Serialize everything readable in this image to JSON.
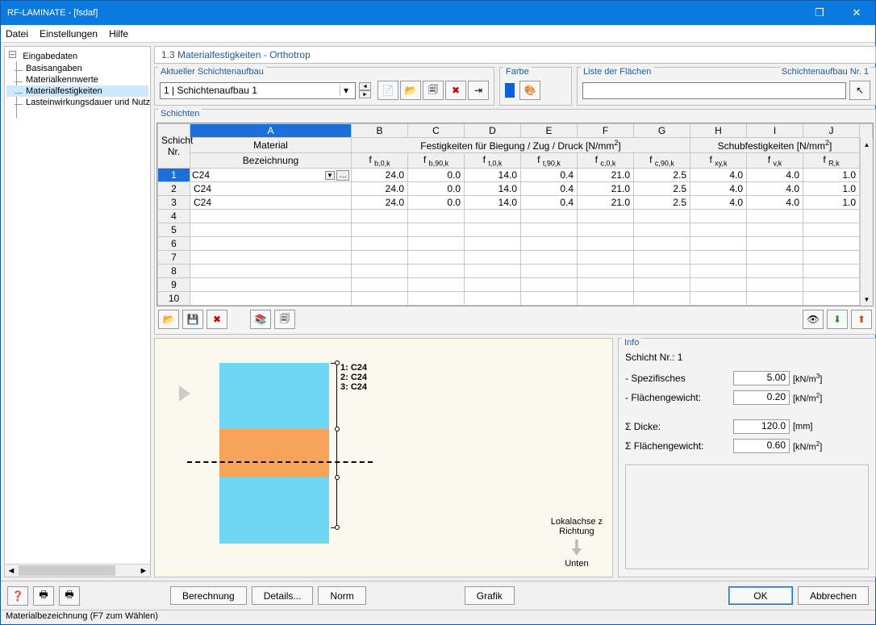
{
  "window": {
    "title": "RF-LAMINATE - [fsdaf]"
  },
  "menu": {
    "file": "Datei",
    "settings": "Einstellungen",
    "help": "Hilfe"
  },
  "tree": {
    "root": "Eingabedaten",
    "items": [
      "Basisangaben",
      "Materialkennwerte",
      "Materialfestigkeiten",
      "Lasteinwirkungsdauer und Nutzungsklasse"
    ],
    "selected_index": 2
  },
  "section_title": "1.3 Materialfestigkeiten - Orthotrop",
  "toolbar": {
    "current_layering": {
      "label": "Aktueller Schichtenaufbau",
      "value": "1 | Schichtenaufbau 1"
    },
    "color": {
      "label": "Farbe"
    },
    "faces": {
      "label": "Liste der Flächen",
      "right": "Schichtenaufbau Nr. 1"
    }
  },
  "grid": {
    "label": "Schichten",
    "col_letters": [
      "A",
      "B",
      "C",
      "D",
      "E",
      "F",
      "G",
      "H",
      "I",
      "J"
    ],
    "corner": "Schicht\nNr.",
    "h1_material": "Material",
    "h1_strength": "Festigkeiten für Biegung / Zug / Druck [N/mm²]",
    "h1_shear": "Schubfestigkeiten [N/mm²]",
    "h2_designation": "Bezeichnung",
    "h2_cols": [
      "f b,0,k",
      "f b,90,k",
      "f t,0,k",
      "f t,90,k",
      "f c,0,k",
      "f c,90,k",
      "f xy,k",
      "f v,k",
      "f R,k"
    ],
    "rows": [
      {
        "n": "1",
        "mat": "C24",
        "b0": "24.0",
        "b90": "0.0",
        "t0": "14.0",
        "t90": "0.4",
        "c0": "21.0",
        "c90": "2.5",
        "xy": "4.0",
        "v": "4.0",
        "r": "1.0",
        "sel": true
      },
      {
        "n": "2",
        "mat": "C24",
        "b0": "24.0",
        "b90": "0.0",
        "t0": "14.0",
        "t90": "0.4",
        "c0": "21.0",
        "c90": "2.5",
        "xy": "4.0",
        "v": "4.0",
        "r": "1.0"
      },
      {
        "n": "3",
        "mat": "C24",
        "b0": "24.0",
        "b90": "0.0",
        "t0": "14.0",
        "t90": "0.4",
        "c0": "21.0",
        "c90": "2.5",
        "xy": "4.0",
        "v": "4.0",
        "r": "1.0"
      },
      {
        "n": "4"
      },
      {
        "n": "5"
      },
      {
        "n": "6"
      },
      {
        "n": "7"
      },
      {
        "n": "8"
      },
      {
        "n": "9"
      },
      {
        "n": "10"
      }
    ]
  },
  "viz": {
    "layer_labels": [
      "1: C24",
      "2: C24",
      "3: C24"
    ],
    "axis_l1": "Lokalachse z",
    "axis_l2": "Richtung",
    "axis_bottom": "Unten"
  },
  "info": {
    "title": "Info",
    "schicht": "Schicht Nr.: 1",
    "rows": [
      {
        "label": "- Spezifisches",
        "value": "5.00",
        "unit": "[kN/m³]"
      },
      {
        "label": "- Flächengewicht:",
        "value": "0.20",
        "unit": "[kN/m²]"
      },
      {
        "spacer": true
      },
      {
        "label": "Σ Dicke:",
        "value": "120.0",
        "unit": "[mm]"
      },
      {
        "label": "Σ Flächengewicht:",
        "value": "0.60",
        "unit": "[kN/m²]"
      }
    ]
  },
  "footer": {
    "calc": "Berechnung",
    "details": "Details...",
    "norm": "Norm",
    "graphic": "Grafik",
    "ok": "OK",
    "cancel": "Abbrechen"
  },
  "status": "Materialbezeichnung (F7 zum Wählen)"
}
